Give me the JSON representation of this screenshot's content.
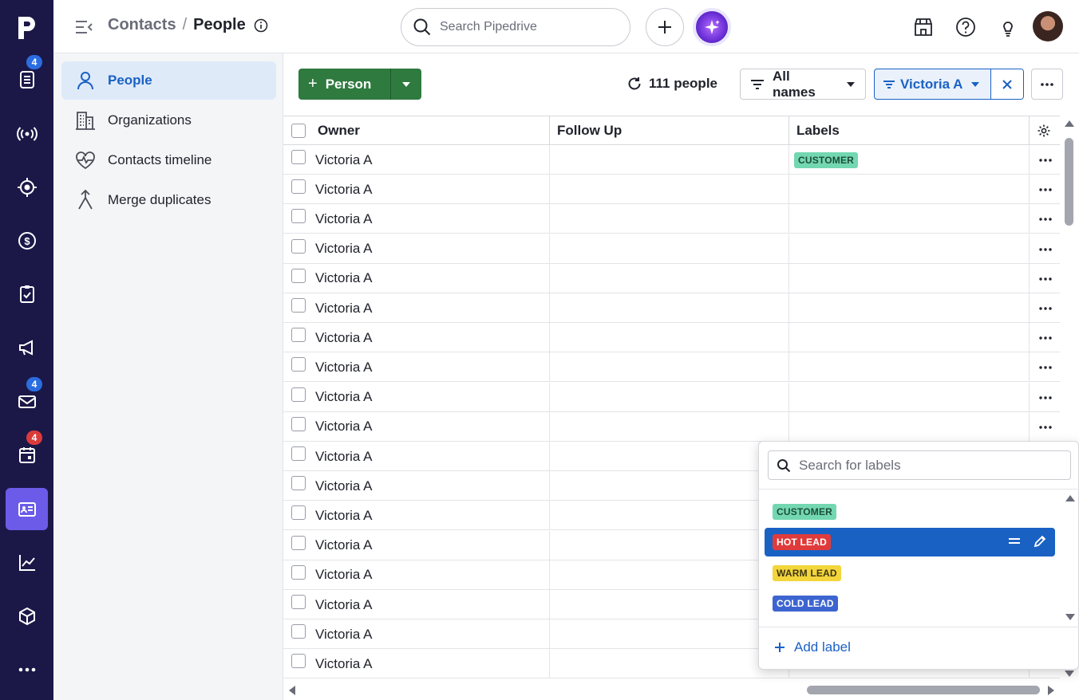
{
  "rail": {
    "badges": {
      "leads": "4",
      "mail": "4",
      "calendar": "4"
    }
  },
  "header": {
    "breadcrumb_parent": "Contacts",
    "breadcrumb_sep": "/",
    "breadcrumb_current": "People",
    "search_placeholder": "Search Pipedrive"
  },
  "sidenav": {
    "items": [
      {
        "label": "People"
      },
      {
        "label": "Organizations"
      },
      {
        "label": "Contacts timeline"
      },
      {
        "label": "Merge duplicates"
      }
    ]
  },
  "toolbar": {
    "add_person_label": "Person",
    "add_plus": "+",
    "count_label": "111 people",
    "filter_label": "All names",
    "active_filter_label": "Victoria A"
  },
  "table": {
    "columns": [
      "Owner",
      "Follow Up",
      "Labels"
    ],
    "rows": [
      {
        "owner": "Victoria A",
        "label": "CUSTOMER"
      },
      {
        "owner": "Victoria A",
        "label": ""
      },
      {
        "owner": "Victoria A",
        "label": ""
      },
      {
        "owner": "Victoria A",
        "label": ""
      },
      {
        "owner": "Victoria A",
        "label": ""
      },
      {
        "owner": "Victoria A",
        "label": ""
      },
      {
        "owner": "Victoria A",
        "label": ""
      },
      {
        "owner": "Victoria A",
        "label": ""
      },
      {
        "owner": "Victoria A",
        "label": ""
      },
      {
        "owner": "Victoria A",
        "label": ""
      },
      {
        "owner": "Victoria A",
        "label": ""
      },
      {
        "owner": "Victoria A",
        "label": ""
      },
      {
        "owner": "Victoria A",
        "label": ""
      },
      {
        "owner": "Victoria A",
        "label": ""
      },
      {
        "owner": "Victoria A",
        "label": ""
      },
      {
        "owner": "Victoria A",
        "label": ""
      },
      {
        "owner": "Victoria A",
        "label": ""
      },
      {
        "owner": "Victoria A",
        "label": ""
      }
    ]
  },
  "label_dropdown": {
    "search_placeholder": "Search for labels",
    "options": [
      {
        "label": "CUSTOMER",
        "color": "#73d7b1"
      },
      {
        "label": "HOT LEAD",
        "color": "#e03b3b"
      },
      {
        "label": "WARM LEAD",
        "color": "#f3d53c"
      },
      {
        "label": "COLD LEAD",
        "color": "#3d65d1"
      }
    ],
    "selected": "HOT LEAD",
    "add_label": "Add label"
  },
  "colors": {
    "rail_bg": "#1b1848",
    "rail_active": "#6b5be8",
    "primary_green": "#2f7a3f",
    "link_blue": "#1a61c4"
  }
}
